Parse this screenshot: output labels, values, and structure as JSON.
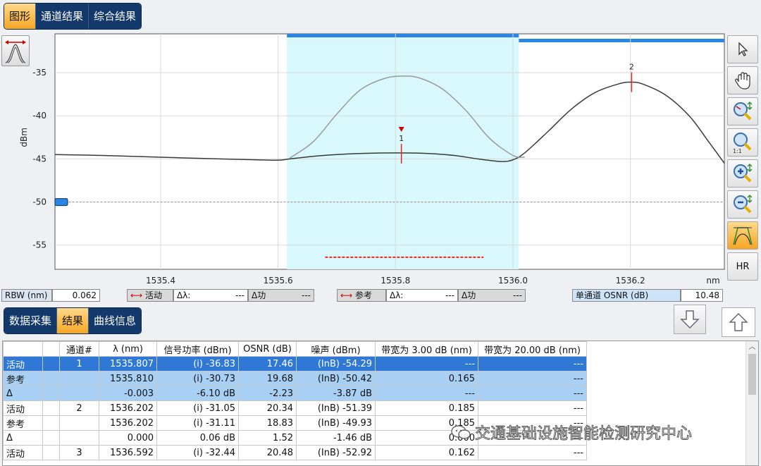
{
  "top_tabs": [
    {
      "label": "图形",
      "active": true
    },
    {
      "label": "通道结果",
      "active": false
    },
    {
      "label": "综合结果",
      "active": false
    }
  ],
  "chart_data": {
    "type": "line",
    "xlabel": "nm",
    "ylabel": "dBm",
    "xlim": [
      1535.22,
      1536.36
    ],
    "ylim": [
      -57.8,
      -30.5
    ],
    "x_ticks": [
      1535.4,
      1535.6,
      1535.8,
      1536.0,
      1536.2
    ],
    "y_ticks": [
      -35,
      -40,
      -45,
      -50,
      -55
    ],
    "grid": true,
    "series": [
      {
        "role": "active",
        "color": "#3a3a3a",
        "x": [
          1535.22,
          1535.3,
          1535.4,
          1535.5,
          1535.56,
          1535.6,
          1535.62,
          1535.66,
          1535.7,
          1535.75,
          1535.8,
          1535.85,
          1535.9,
          1535.94,
          1535.98,
          1536.0,
          1536.02,
          1536.06,
          1536.1,
          1536.14,
          1536.18,
          1536.2,
          1536.22,
          1536.26,
          1536.3,
          1536.33,
          1536.36
        ],
        "values": [
          -44.5,
          -44.6,
          -44.8,
          -45.0,
          -45.1,
          -45.15,
          -45.0,
          -44.7,
          -44.5,
          -44.35,
          -44.3,
          -44.35,
          -44.6,
          -45.0,
          -45.3,
          -45.1,
          -44.3,
          -41.8,
          -39.2,
          -37.3,
          -36.3,
          -36.1,
          -36.3,
          -37.6,
          -40.0,
          -42.7,
          -45.5
        ]
      },
      {
        "role": "reference",
        "color": "#9a9a9a",
        "x": [
          1535.62,
          1535.66,
          1535.7,
          1535.74,
          1535.78,
          1535.81,
          1535.84,
          1535.88,
          1535.92,
          1535.96,
          1536.0,
          1536.02
        ],
        "values": [
          -44.9,
          -43.0,
          -39.8,
          -37.0,
          -35.7,
          -35.4,
          -35.6,
          -36.9,
          -39.4,
          -42.6,
          -44.6,
          -44.8
        ]
      }
    ],
    "markers": [
      {
        "label": "1",
        "x": 1535.81,
        "y": -44.4
      },
      {
        "label": "2",
        "x": 1536.202,
        "y": -36.1
      }
    ],
    "shaded_region": [
      1535.615,
      1536.01
    ],
    "threshold_y": -50,
    "noise_bar": {
      "x": [
        1535.68,
        1535.95
      ],
      "y": -56.4
    }
  },
  "status": {
    "rbw_label": "RBW (nm)",
    "rbw_value": "0.062",
    "active_label": "活动",
    "delta_lambda_label": "Δλ:",
    "delta_lambda_value": "---",
    "delta_power_label": "Δ功",
    "delta_power_value": "---",
    "ref_label": "参考",
    "ref_dl_label": "Δλ:",
    "ref_dl_value": "---",
    "ref_dp_label": "Δ功",
    "ref_dp_value": "---",
    "osnr_label": "单通道 OSNR (dB)",
    "osnr_value": "10.48"
  },
  "toolbar": {
    "hr_label": "HR"
  },
  "bottom_tabs": [
    {
      "label": "数据采集",
      "active": false
    },
    {
      "label": "结果",
      "active": true
    },
    {
      "label": "曲线信息",
      "active": false
    }
  ],
  "table": {
    "headers": [
      "",
      "通道#",
      "λ (nm)",
      "信号功率 (dBm)",
      "OSNR (dB)",
      "噪声 (dBm)",
      "带宽为 3.00 dB (nm)",
      "带宽为 20.00 dB (nm)"
    ],
    "rows": [
      {
        "style": "sel",
        "cells": [
          "活动",
          "1",
          "1535.807",
          "(i) -36.83",
          "17.46",
          "(InB) -54.29",
          "---",
          "---"
        ]
      },
      {
        "style": "hl",
        "cells": [
          "参考",
          "",
          "1535.810",
          "(i) -30.73",
          "19.68",
          "(InB) -50.42",
          "0.165",
          "---"
        ]
      },
      {
        "style": "hl",
        "cells": [
          "Δ",
          "",
          "-0.003",
          "-6.10 dB",
          "-2.23",
          "-3.87 dB",
          "---",
          "---"
        ]
      },
      {
        "style": "",
        "cells": [
          "活动",
          "2",
          "1536.202",
          "(i) -31.05",
          "20.34",
          "(InB) -51.39",
          "0.185",
          "---"
        ]
      },
      {
        "style": "",
        "cells": [
          "参考",
          "",
          "1536.202",
          "(i) -31.11",
          "18.83",
          "(InB) -49.93",
          "0.185",
          "---"
        ]
      },
      {
        "style": "",
        "cells": [
          "Δ",
          "",
          "0.000",
          "0.06 dB",
          "1.52",
          "-1.46 dB",
          "0.000",
          "---"
        ]
      },
      {
        "style": "",
        "cells": [
          "活动",
          "3",
          "1536.592",
          "(i) -32.44",
          "20.48",
          "(InB) -52.92",
          "0.162",
          "---"
        ]
      }
    ]
  },
  "watermark": "交通基础设施智能检测研究中心"
}
